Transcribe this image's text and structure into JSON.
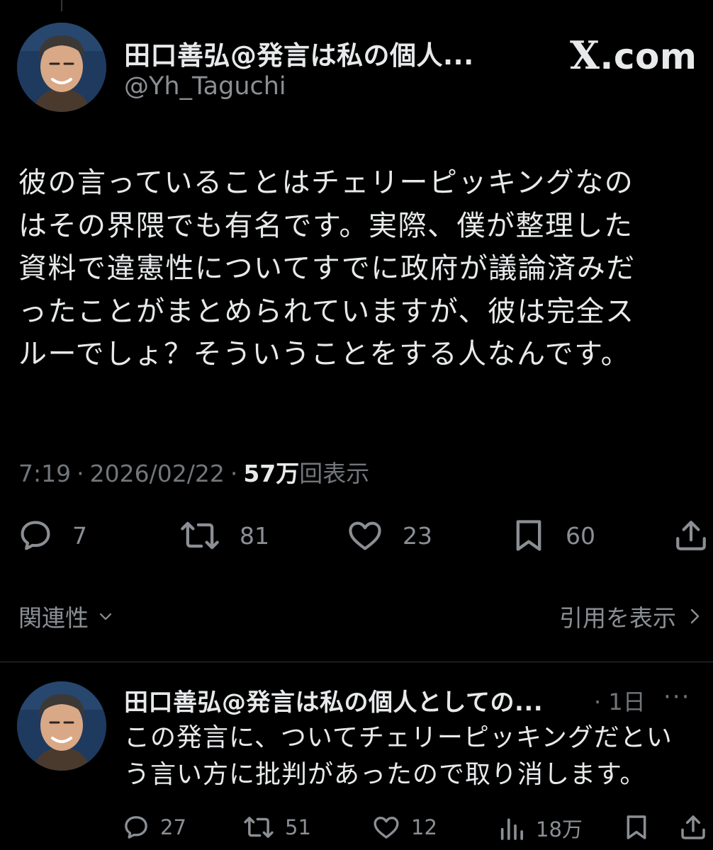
{
  "site": {
    "logo_text": ".com",
    "logo_glyph": "X"
  },
  "main_tweet": {
    "author": {
      "name": "田口善弘@発言は私の個人...",
      "handle": "@Yh_Taguchi"
    },
    "body_lines": [
      "彼の言っていることはチェリーピッキングなの",
      "はその界隈でも有名です。実際、僕が整理した",
      "資料で違憲性についてすでに政府が議論済みだ",
      "ったことがまとめられていますが、彼は完全ス",
      "ルーでしょ？そういうことをする人なんです。"
    ],
    "meta": {
      "time": "7:19",
      "date": "2026/02/22",
      "separator": "·",
      "views_count": "57万",
      "views_label": "回表示"
    },
    "actions": {
      "replies": "7",
      "reposts": "81",
      "likes": "23",
      "bookmarks": "60"
    },
    "related_label": "関連性",
    "quotes_label": "引用を表示"
  },
  "reply_tweet": {
    "author_name": "田口善弘@発言は私の個人としての...",
    "time": "· 1日",
    "more": "···",
    "body_lines": [
      "この発言に、ついてチェリーピッキングだとい",
      "う言い方に批判があったので取り消します。"
    ],
    "actions": {
      "replies": "27",
      "reposts": "51",
      "likes": "12",
      "views": "18万"
    }
  },
  "icons": {
    "reply": "comment-bubble-icon",
    "repost": "repost-arrows-icon",
    "like": "heart-icon",
    "bookmark": "bookmark-icon",
    "share": "share-upload-icon",
    "views": "bar-chart-icon",
    "chevron_down": "chevron-down-icon",
    "chevron_right": "chevron-right-icon"
  },
  "colors": {
    "background": "#000000",
    "text_primary": "#e7e9ea",
    "text_secondary": "#71767b",
    "divider": "#2f3336"
  }
}
